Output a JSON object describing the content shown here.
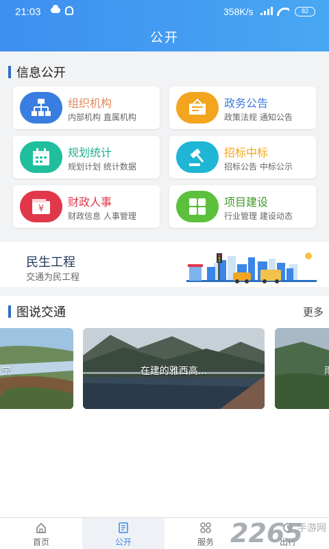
{
  "status_bar": {
    "time": "21:03",
    "speed": "358K/s",
    "battery": "82"
  },
  "header": {
    "title": "公开"
  },
  "info_section": {
    "title": "信息公开",
    "cards": [
      {
        "title": "组织机构",
        "subtitle": "内部机构 直属机构",
        "color": "#3a7de0",
        "title_color": "#e08a5a",
        "icon": "org-chart-icon"
      },
      {
        "title": "政务公告",
        "subtitle": "政策法规 通知公告",
        "color": "#f3a51f",
        "title_color": "#3a7de0",
        "icon": "notice-board-icon"
      },
      {
        "title": "规划统计",
        "subtitle": "规划计划 统计数据",
        "color": "#1fbf9d",
        "title_color": "#1fae91",
        "icon": "calendar-icon"
      },
      {
        "title": "招标中标",
        "subtitle": "招标公告 中标公示",
        "color": "#1fb6d5",
        "title_color": "#f3a51f",
        "icon": "gavel-icon"
      },
      {
        "title": "财政人事",
        "subtitle": "财政信息 人事管理",
        "color": "#e0384a",
        "title_color": "#e0384a",
        "icon": "yuan-wallet-icon"
      },
      {
        "title": "项目建设",
        "subtitle": "行业管理 建设动态",
        "color": "#5cc03c",
        "title_color": "#3f9a2a",
        "icon": "grid-icon"
      }
    ]
  },
  "banner": {
    "title": "民生工程",
    "subtitle": "交通为民工程"
  },
  "photo_section": {
    "title": "图说交通",
    "more": "更多",
    "photos": [
      {
        "caption": "宁..."
      },
      {
        "caption": "在建的雅西高..."
      },
      {
        "caption": "雨"
      }
    ]
  },
  "bottom_nav": [
    {
      "label": "首页",
      "icon": "home-icon",
      "active": false
    },
    {
      "label": "公开",
      "icon": "document-icon",
      "active": true
    },
    {
      "label": "服务",
      "icon": "grid-circles-icon",
      "active": false
    },
    {
      "label": "出行",
      "icon": "travel-icon",
      "active": false
    }
  ],
  "watermark": {
    "brand": "2265",
    "text": "手游网"
  }
}
